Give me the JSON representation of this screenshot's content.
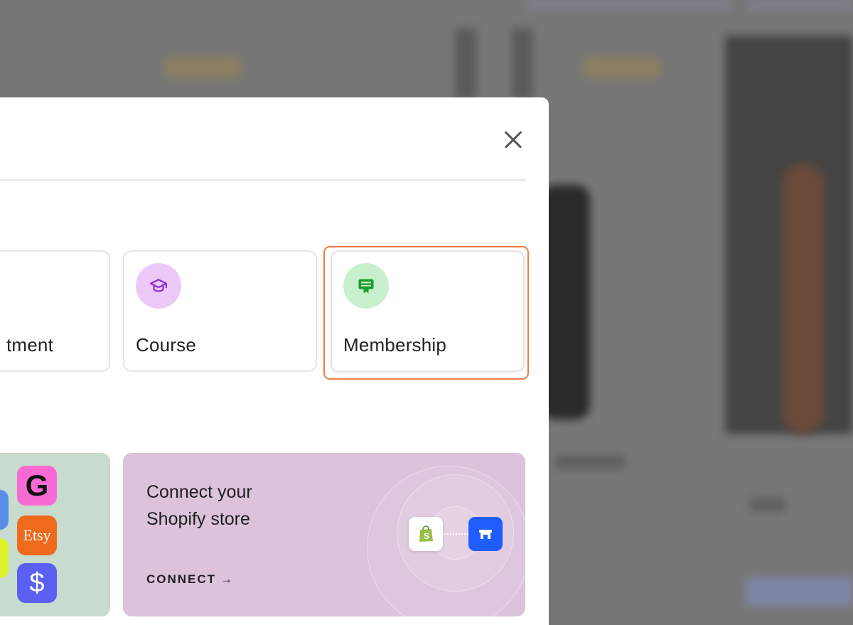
{
  "modal": {
    "cards": [
      {
        "id": "appointment",
        "label": "tment",
        "icon": "calendar-icon"
      },
      {
        "id": "course",
        "label": "Course",
        "icon": "graduation-cap-icon",
        "icon_bg": "#ecc9f8",
        "icon_color": "#8a2ad8"
      },
      {
        "id": "membership",
        "label": "Membership",
        "icon": "membership-badge-icon",
        "icon_bg": "#c9f0cc",
        "icon_color": "#1e9a2e"
      }
    ],
    "promo": {
      "title": "Connect your Shopify store",
      "cta": "CONNECT",
      "cta_arrow": "→"
    },
    "brands": {
      "g": "G",
      "etsy": "Etsy",
      "dollar": "$",
      "s": "S"
    },
    "highlight_color": "#f07a45"
  }
}
